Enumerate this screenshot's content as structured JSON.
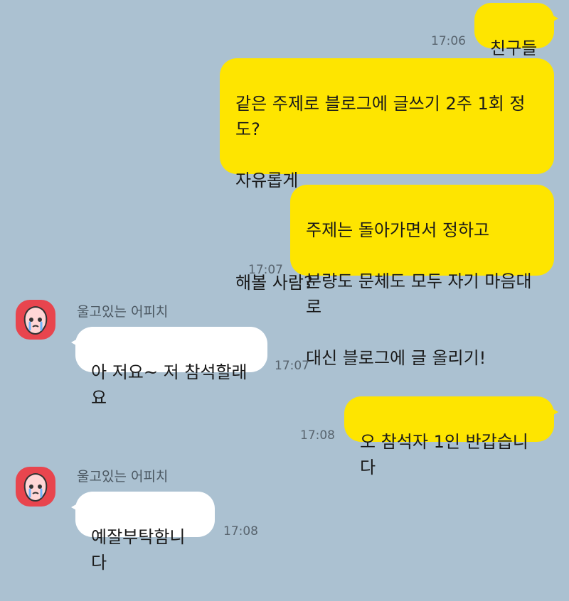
{
  "chat": {
    "messages": [
      {
        "from": "me",
        "lines": [
          "친구들"
        ],
        "time": "17:06"
      },
      {
        "from": "me",
        "lines": [
          "같은 주제로 블로그에 글쓰기 2주 1회 정도?",
          "자유롭게",
          "",
          "해볼 사람?"
        ],
        "time": ""
      },
      {
        "from": "me",
        "lines": [
          "주제는 돌아가면서 정하고",
          "분량도 문체도 모두 자기 마음대로",
          "대신 블로그에 글 올리기!"
        ],
        "time": "17:07"
      },
      {
        "from": "other",
        "sender": "울고있는 어피치",
        "avatar": "crying-apeach-icon",
        "lines": [
          "아 저요~ 저 참석할래요"
        ],
        "time": "17:07"
      },
      {
        "from": "me",
        "lines": [
          "오 참석자 1인 반갑습니다"
        ],
        "time": "17:08"
      },
      {
        "from": "other",
        "sender": "울고있는 어피치",
        "avatar": "crying-apeach-icon",
        "lines": [
          "예잘부탁함니다"
        ],
        "time": "17:08"
      }
    ]
  },
  "colors": {
    "background": "#abc1d1",
    "my_bubble": "#fee500",
    "their_bubble": "#ffffff",
    "avatar": "#e8454e"
  }
}
